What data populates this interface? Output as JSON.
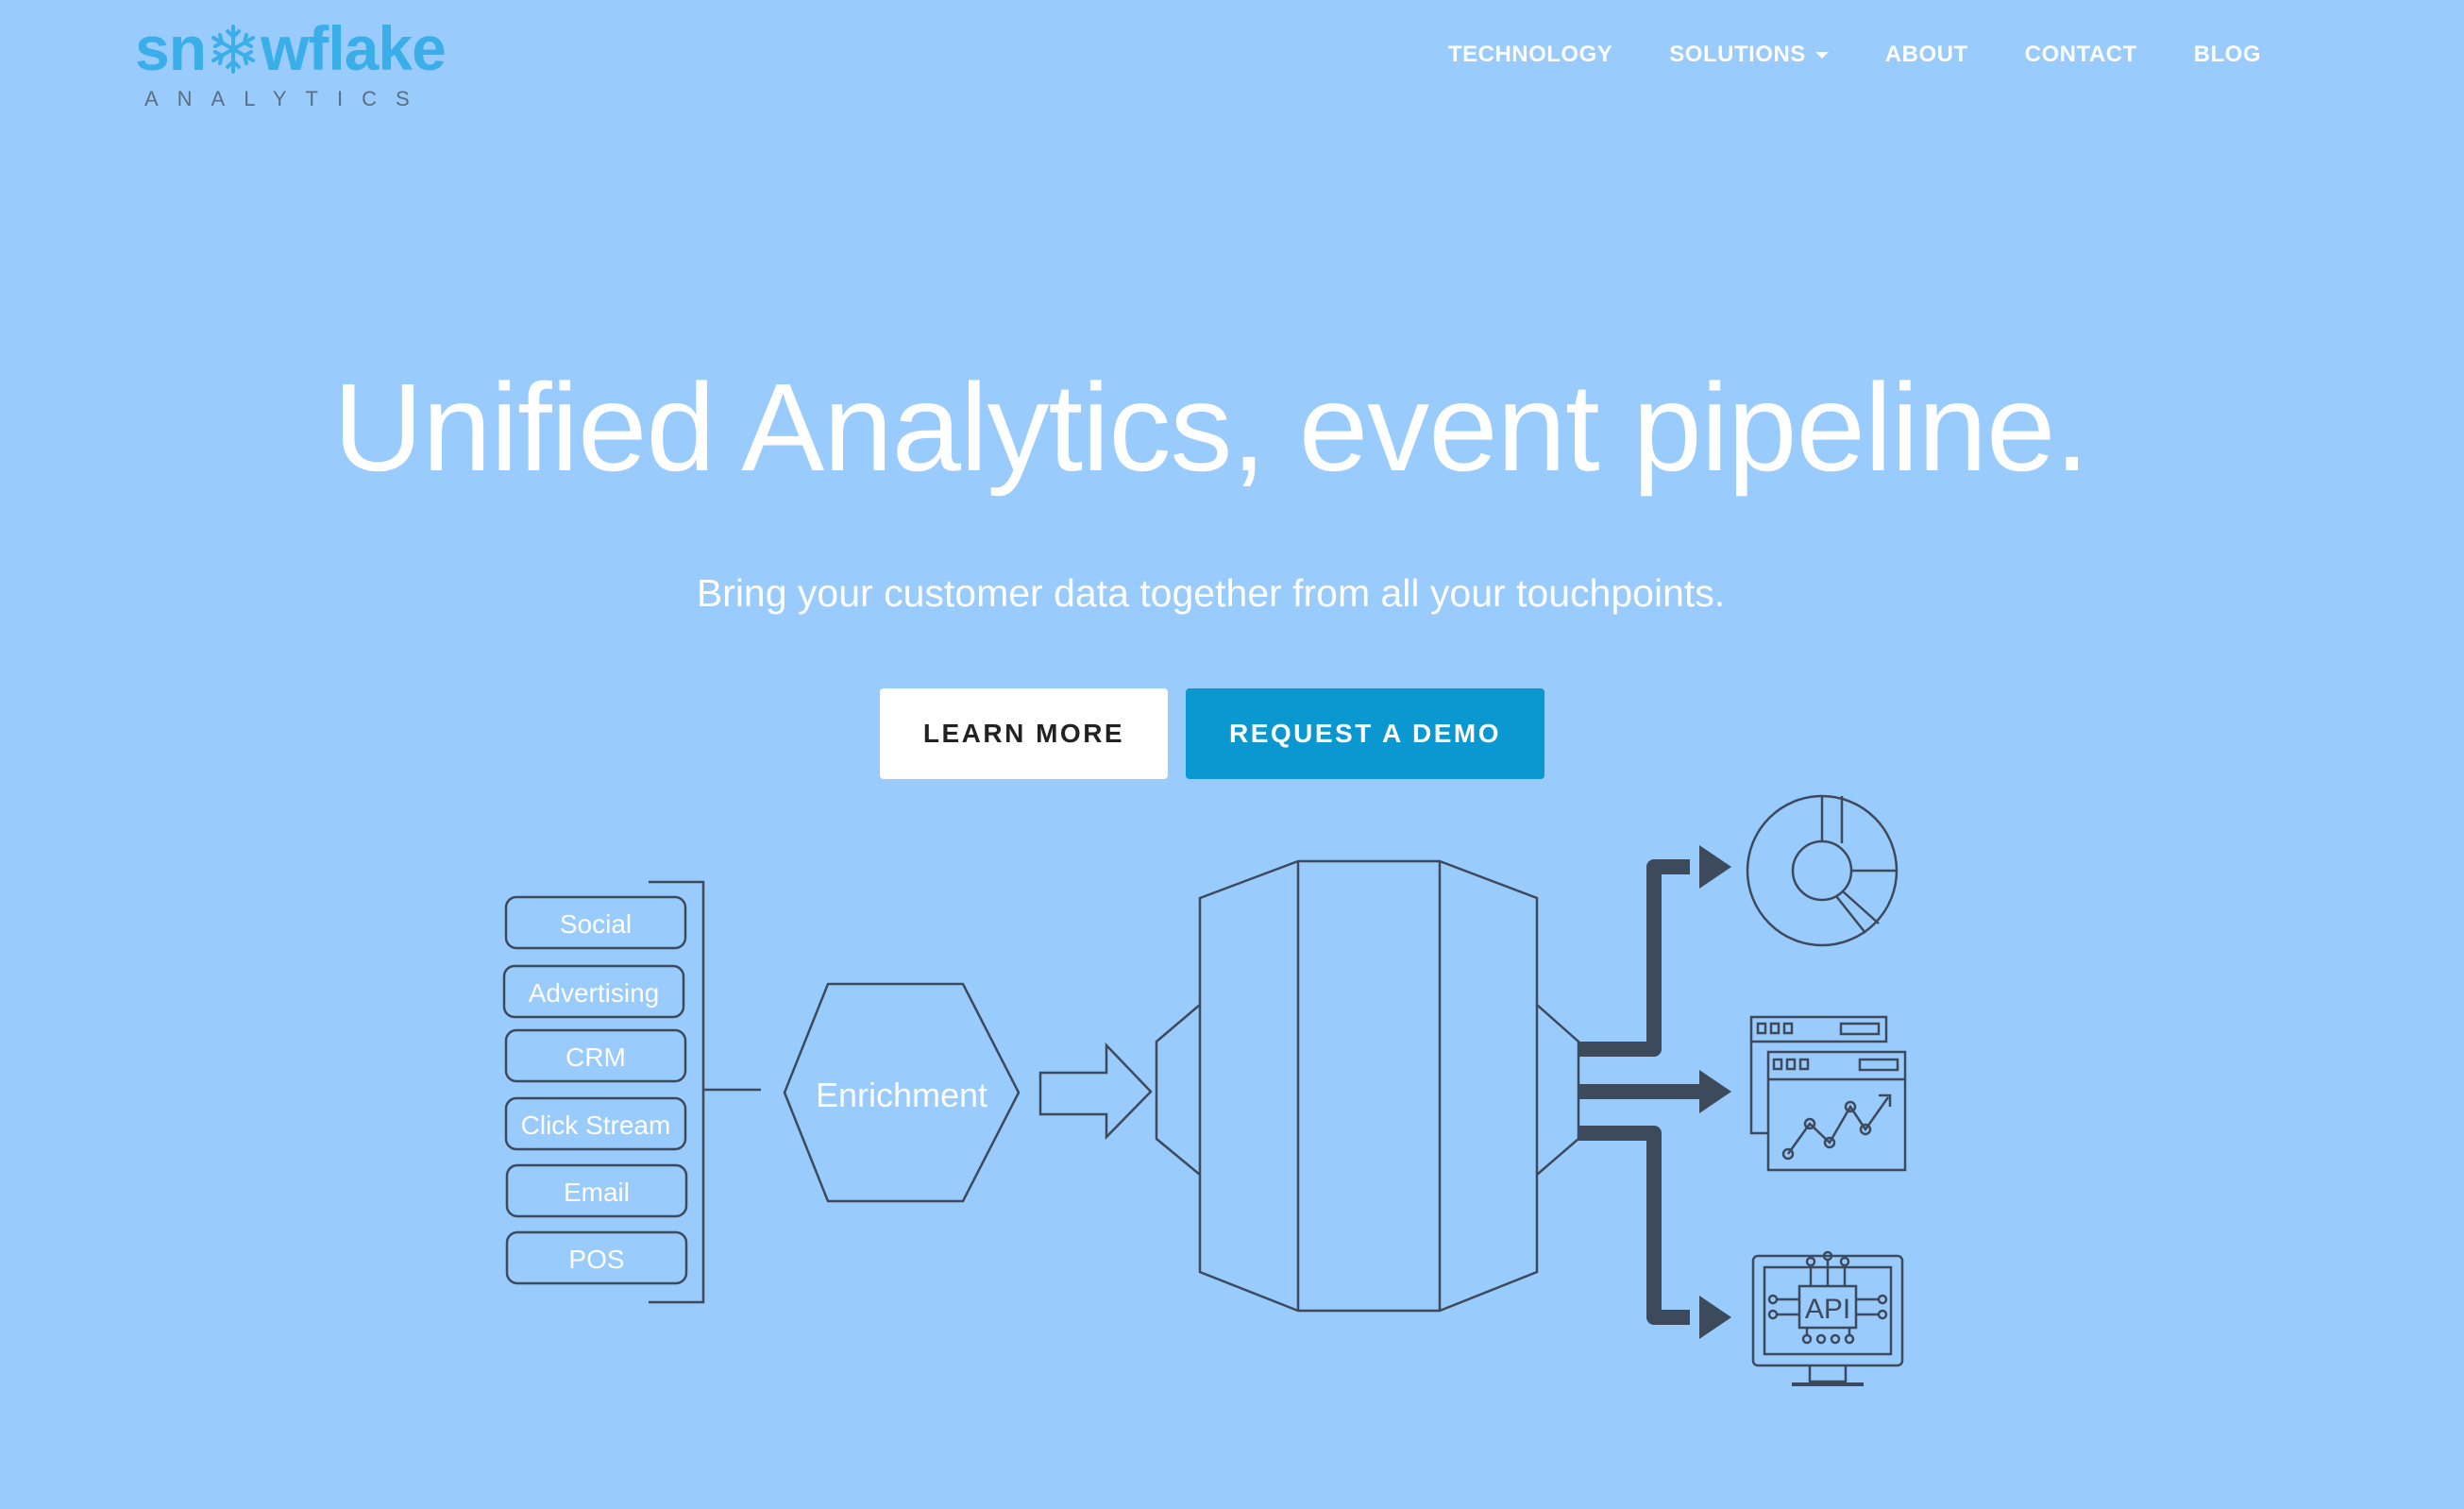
{
  "brand": {
    "logo_word": "snowflake",
    "logo_sub": "ANALYTICS",
    "accent": "#3aaee8"
  },
  "nav": {
    "items": [
      {
        "label": "TECHNOLOGY"
      },
      {
        "label": "SOLUTIONS",
        "has_dropdown": true
      },
      {
        "label": "ABOUT"
      },
      {
        "label": "CONTACT"
      },
      {
        "label": "BLOG"
      }
    ]
  },
  "hero": {
    "title": "Unified Analytics, event pipeline.",
    "subtitle": "Bring your customer data together from all your touchpoints.",
    "learn_more": "LEARN MORE",
    "request_demo": "REQUEST A DEMO"
  },
  "diagram": {
    "sources": [
      "Social",
      "Advertising",
      "CRM",
      "Click Stream",
      "Email",
      "POS"
    ],
    "enrichment": "Enrichment",
    "api_label": "API",
    "outputs": [
      "pie-chart-icon",
      "dashboard-icon",
      "api-monitor-icon"
    ]
  },
  "colors": {
    "background": "#99cbfd",
    "demo_button": "#0b98d0",
    "stroke": "#3d4a5c"
  }
}
